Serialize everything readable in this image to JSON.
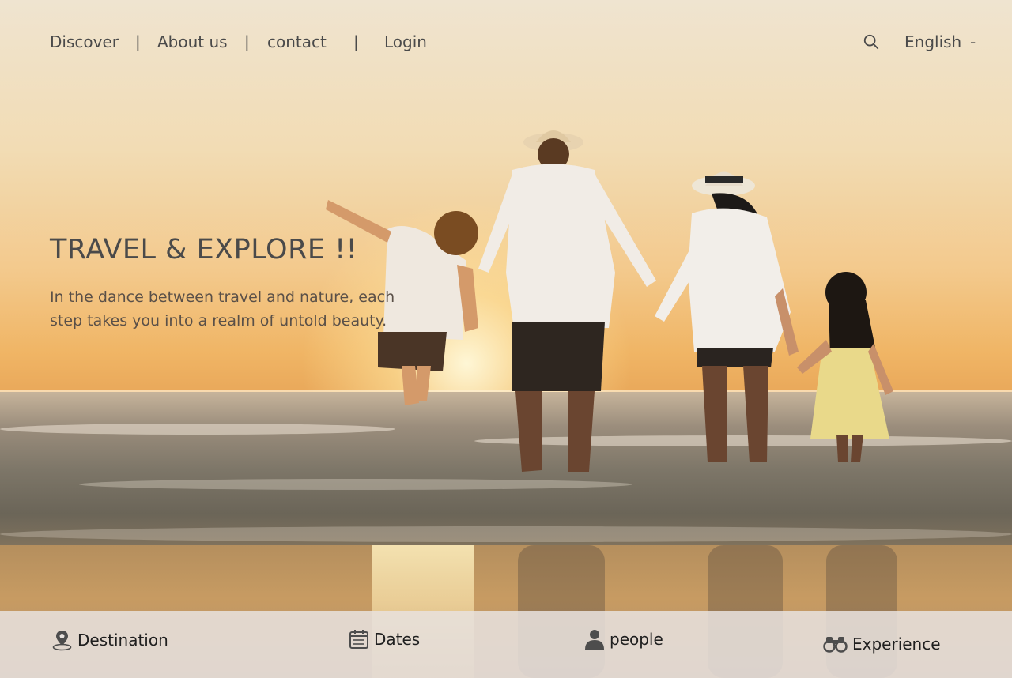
{
  "nav": {
    "links": [
      "Discover",
      "About us",
      "contact",
      "Login"
    ],
    "separator": "|",
    "search_icon": "search-icon",
    "language": "English",
    "language_caret": "-"
  },
  "hero": {
    "title": "TRAVEL & EXPLORE !!",
    "description": "In the dance between travel and nature, each step takes you into a realm of untold  beauty."
  },
  "booking_bar": {
    "items": [
      {
        "label": "Destination",
        "icon": "map-pin-icon"
      },
      {
        "label": "Dates",
        "icon": "calendar-icon"
      },
      {
        "label": "people",
        "icon": "person-icon"
      },
      {
        "label": "Experience",
        "icon": "binoculars-icon"
      }
    ]
  },
  "colors": {
    "text": "#4a4a4a",
    "bar_background": "#e8e2de",
    "sky_top": "#efe4d0",
    "sun": "#f0b565"
  }
}
